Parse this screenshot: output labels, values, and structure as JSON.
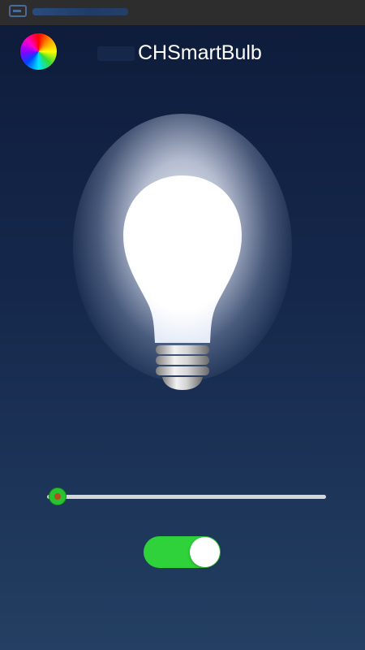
{
  "status_bar": {
    "icon": "app-notification-icon"
  },
  "header": {
    "title": "CHSmartBulb",
    "color_picker_icon": "color-wheel-icon"
  },
  "bulb": {
    "icon": "light-bulb-icon",
    "state": "on"
  },
  "brightness_slider": {
    "value": 0.03
  },
  "power_toggle": {
    "checked": true
  },
  "colors": {
    "accent": "#2fd23a",
    "background_top": "#0e1b3a",
    "background_bottom": "#233f62"
  }
}
